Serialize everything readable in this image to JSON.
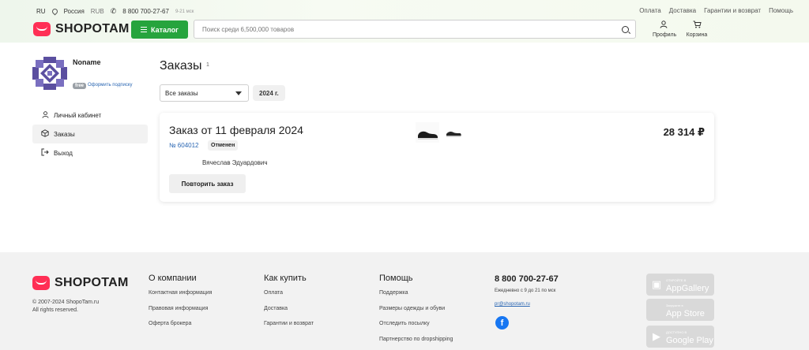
{
  "topbar": {
    "lang": "RU",
    "region": "Россия",
    "currency": "RUB",
    "phone": "8 800 700-27-67",
    "hours": "9-21 мск",
    "links": [
      "Оплата",
      "Доставка",
      "Гарантии и возврат",
      "Помощь"
    ]
  },
  "header": {
    "logo": "SHOPOTAM",
    "catalog_label": "Каталог",
    "search_placeholder": "Поиск среди 6,500,000 товаров",
    "profile_label": "Профиль",
    "cart_label": "Корзина"
  },
  "sidebar": {
    "username": "Noname",
    "badge": "free",
    "subscribe_link": "Оформить подписку",
    "items": [
      {
        "label": "Личный кабинет",
        "icon": "user-icon"
      },
      {
        "label": "Заказы",
        "icon": "box-icon",
        "active": true
      },
      {
        "label": "Выход",
        "icon": "logout-icon"
      }
    ]
  },
  "main": {
    "title": "Заказы",
    "count": "1",
    "filter_value": "Все заказы",
    "year_chip": "2024 г."
  },
  "order": {
    "title": "Заказ от 11 февраля 2024",
    "number": "№ 604012",
    "status": "Отменен",
    "recipient": "Вячеслав Эдуардович",
    "repeat_label": "Повторить заказ",
    "price": "28 314 ₽"
  },
  "footer": {
    "logo": "SHOPOTAM",
    "copyright_1": "© 2007-2024 ShopoTam.ru",
    "copyright_2": "All rights reserved.",
    "columns": [
      {
        "title": "О компании",
        "links": [
          "Контактная информация",
          "Правовая информация",
          "Оферта брокера"
        ]
      },
      {
        "title": "Как купить",
        "links": [
          "Оплата",
          "Доставка",
          "Гарантии и возврат"
        ]
      },
      {
        "title": "Помощь",
        "links": [
          "Поддержка",
          "Размеры одежды и обуви",
          "Отследить посылку",
          "Партнерство по dropshipping"
        ]
      }
    ],
    "phone": "8 800 700-27-67",
    "hours": "Ежедневно с 9 до 21 по мск",
    "email": "pr@shopotam.ru",
    "stores": [
      {
        "small": "ОТКРОЙТЕ В",
        "big": "AppGallery",
        "icon": "appgallery-icon"
      },
      {
        "small": "Загрузите в",
        "big": "App Store",
        "icon": "apple-icon"
      },
      {
        "small": "ДОСТУПНО В",
        "big": "Google Play",
        "icon": "google-play-icon"
      }
    ]
  },
  "colors": {
    "brand": "#ff2f55",
    "catalog_green": "#26a43d",
    "link_blue": "#2b67b3"
  }
}
